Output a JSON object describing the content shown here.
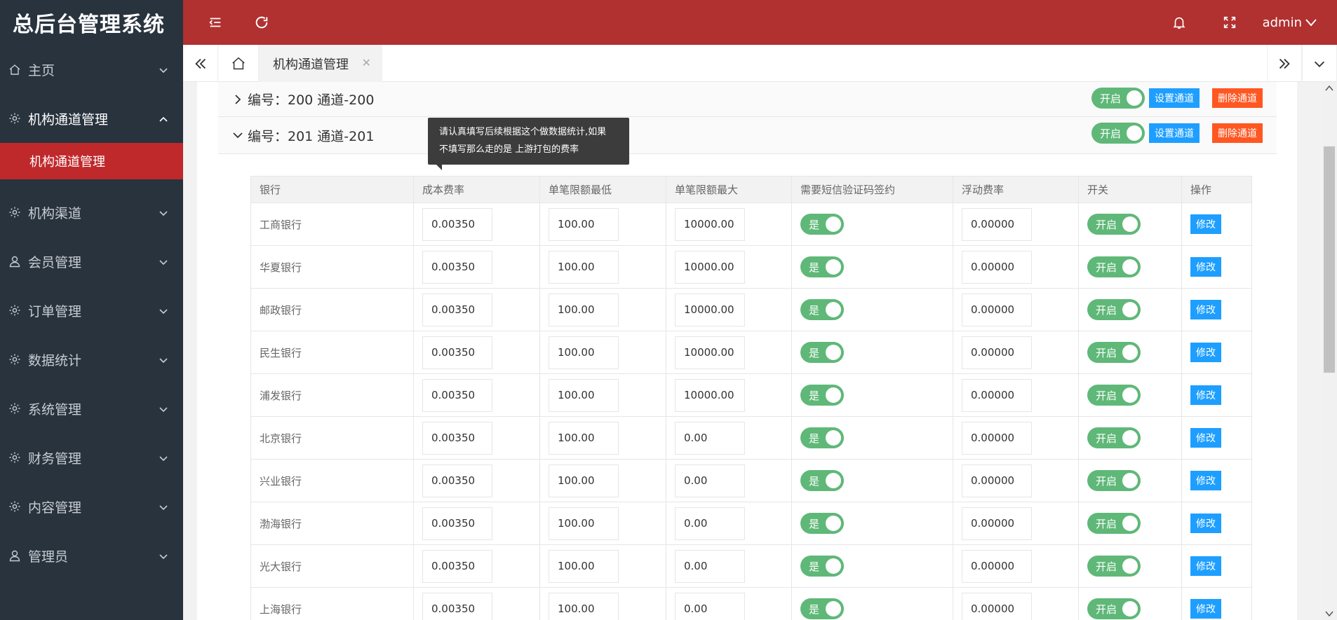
{
  "app": {
    "title": "总后台管理系统"
  },
  "sidebar": {
    "items": [
      {
        "label": "主页",
        "icon": "home-icon"
      },
      {
        "label": "机构通道管理",
        "icon": "gear-icon",
        "open": true,
        "sub": "机构通道管理"
      },
      {
        "label": "机构渠道",
        "icon": "gear-icon"
      },
      {
        "label": "会员管理",
        "icon": "user-icon"
      },
      {
        "label": "订单管理",
        "icon": "gear-icon"
      },
      {
        "label": "数据统计",
        "icon": "gear-icon"
      },
      {
        "label": "系统管理",
        "icon": "gear-icon"
      },
      {
        "label": "财务管理",
        "icon": "gear-icon"
      },
      {
        "label": "内容管理",
        "icon": "gear-icon"
      },
      {
        "label": "管理员",
        "icon": "user-icon"
      }
    ]
  },
  "header": {
    "user": "admin"
  },
  "tabs": {
    "active": "机构通道管理"
  },
  "channels": [
    {
      "label": "编号：200 通道-200",
      "switch": "开启",
      "set": "设置通道",
      "del": "删除通道"
    },
    {
      "label": "编号：201 通道-201",
      "switch": "开启",
      "set": "设置通道",
      "del": "删除通道"
    }
  ],
  "tooltip": {
    "line1": "请认真填写后续根据这个做数据统计,如果",
    "line2": "不填写那么走的是 上游打包的费率"
  },
  "table": {
    "headers": [
      "银行",
      "成本费率",
      "单笔限额最低",
      "单笔限额最大",
      "需要短信验证码签约",
      "浮动费率",
      "开关",
      "操作"
    ],
    "sms_label": "是",
    "switch_label": "开启",
    "edit_label": "修改",
    "rows": [
      {
        "bank": "工商银行",
        "cost": "0.00350",
        "min": "100.00",
        "max": "10000.00",
        "float": "0.00000"
      },
      {
        "bank": "华夏银行",
        "cost": "0.00350",
        "min": "100.00",
        "max": "10000.00",
        "float": "0.00000"
      },
      {
        "bank": "邮政银行",
        "cost": "0.00350",
        "min": "100.00",
        "max": "10000.00",
        "float": "0.00000"
      },
      {
        "bank": "民生银行",
        "cost": "0.00350",
        "min": "100.00",
        "max": "10000.00",
        "float": "0.00000"
      },
      {
        "bank": "浦发银行",
        "cost": "0.00350",
        "min": "100.00",
        "max": "10000.00",
        "float": "0.00000"
      },
      {
        "bank": "北京银行",
        "cost": "0.00350",
        "min": "100.00",
        "max": "0.00",
        "float": "0.00000"
      },
      {
        "bank": "兴业银行",
        "cost": "0.00350",
        "min": "100.00",
        "max": "0.00",
        "float": "0.00000"
      },
      {
        "bank": "渤海银行",
        "cost": "0.00350",
        "min": "100.00",
        "max": "0.00",
        "float": "0.00000"
      },
      {
        "bank": "光大银行",
        "cost": "0.00350",
        "min": "100.00",
        "max": "0.00",
        "float": "0.00000"
      },
      {
        "bank": "上海银行",
        "cost": "0.00350",
        "min": "100.00",
        "max": "0.00",
        "float": "0.00000"
      }
    ]
  }
}
